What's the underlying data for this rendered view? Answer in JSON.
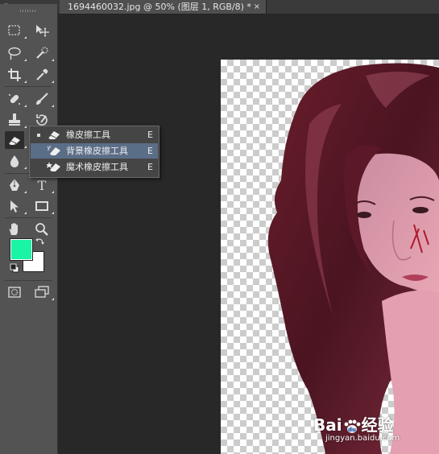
{
  "tabstrip": {
    "collapse_glyph": "«",
    "document_tab": {
      "title": "1694460032.jpg @ 50% (图层 1, RGB/8) *",
      "close_glyph": "×"
    }
  },
  "toolbar": {
    "tools": [
      "rectangular-marquee-icon",
      "move-icon",
      "lasso-icon",
      "quick-selection-icon",
      "crop-icon",
      "eyedropper-icon",
      "spot-healing-icon",
      "brush-icon",
      "clone-stamp-icon",
      "history-brush-icon",
      "eraser-icon",
      "gradient-icon",
      "blur-icon",
      "dodge-icon",
      "pen-icon",
      "type-icon",
      "path-selection-icon",
      "rectangle-icon",
      "hand-icon",
      "zoom-icon"
    ],
    "type_tool_glyph": "T",
    "foreground_color": "#19f5a3",
    "background_color": "#ffffff"
  },
  "flyout": {
    "items": [
      {
        "label": "橡皮擦工具",
        "shortcut": "E",
        "icon": "eraser-icon",
        "current": true
      },
      {
        "label": "背景橡皮擦工具",
        "shortcut": "E",
        "icon": "background-eraser-icon",
        "current": false
      },
      {
        "label": "魔术橡皮擦工具",
        "shortcut": "E",
        "icon": "magic-eraser-icon",
        "current": false
      }
    ],
    "highlighted_index": 1,
    "highlight_color": "#5b6e88"
  },
  "watermark": {
    "logo_left": "Bai",
    "logo_right": "经验",
    "url": "jingyan.baidu.com"
  }
}
